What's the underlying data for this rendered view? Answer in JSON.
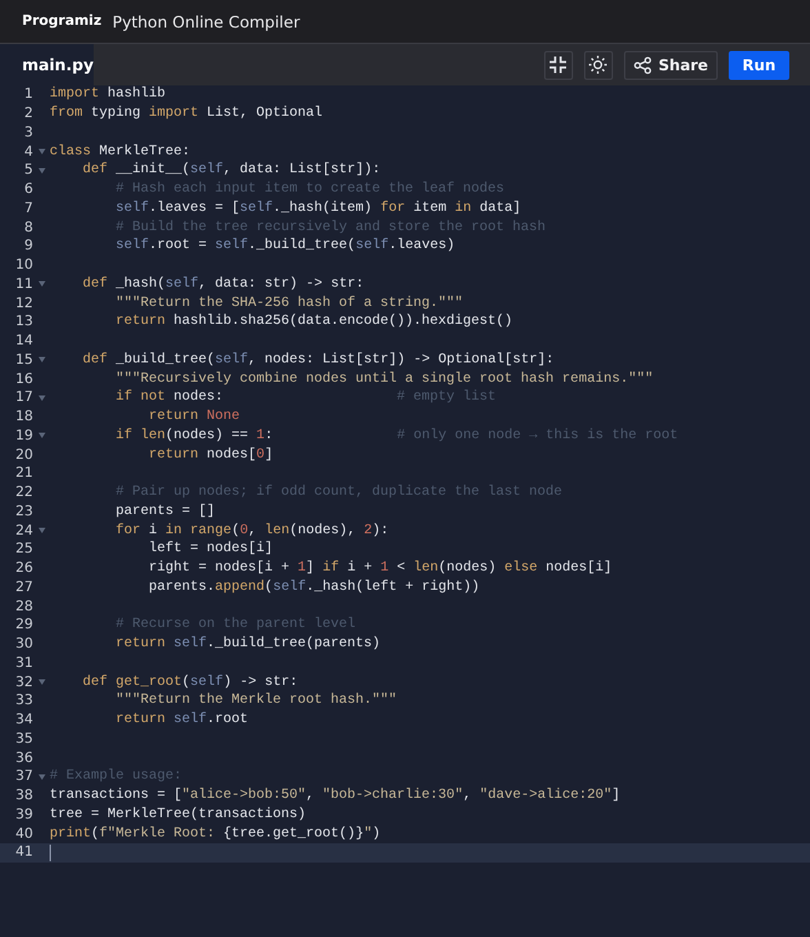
{
  "header": {
    "brand": "Programiz",
    "title": "Python Online Compiler"
  },
  "tabs": [
    {
      "label": "main.py",
      "selected": true
    }
  ],
  "toolbar": {
    "share": "Share",
    "run": "Run"
  },
  "editor": {
    "lines": [
      {
        "number": "1",
        "foldable": false,
        "active": false,
        "tokens": [
          {
            "kind": "keyword",
            "text": "import"
          },
          {
            "kind": "plain",
            "text": " hashlib"
          }
        ]
      },
      {
        "number": "2",
        "foldable": false,
        "active": false,
        "tokens": [
          {
            "kind": "keyword",
            "text": "from"
          },
          {
            "kind": "plain",
            "text": " typing "
          },
          {
            "kind": "keyword",
            "text": "import"
          },
          {
            "kind": "plain",
            "text": " List, Optional"
          }
        ]
      },
      {
        "number": "3",
        "foldable": false,
        "active": false
      },
      {
        "number": "4",
        "foldable": true,
        "active": false,
        "tokens": [
          {
            "kind": "keyword",
            "text": "class"
          },
          {
            "kind": "plain",
            "text": " MerkleTree:"
          }
        ]
      },
      {
        "number": "5",
        "foldable": true,
        "active": false,
        "tokens": [
          {
            "kind": "keyword",
            "text": "    def"
          },
          {
            "kind": "plain",
            "text": " __init__("
          },
          {
            "kind": "self",
            "text": "self"
          },
          {
            "kind": "plain",
            "text": ", data: List[str]):"
          }
        ]
      },
      {
        "number": "6",
        "foldable": false,
        "active": false,
        "tokens": [
          {
            "kind": "comment",
            "text": "        # Hash each input item to create the leaf nodes"
          }
        ]
      },
      {
        "number": "7",
        "foldable": false,
        "active": false,
        "tokens": [
          {
            "kind": "self",
            "text": "        self"
          },
          {
            "kind": "plain",
            "text": ".leaves = ["
          },
          {
            "kind": "self",
            "text": "self"
          },
          {
            "kind": "plain",
            "text": "._hash(item) "
          },
          {
            "kind": "keyword",
            "text": "for"
          },
          {
            "kind": "plain",
            "text": " item "
          },
          {
            "kind": "keyword",
            "text": "in"
          },
          {
            "kind": "plain",
            "text": " data]"
          }
        ]
      },
      {
        "number": "8",
        "foldable": false,
        "active": false,
        "tokens": [
          {
            "kind": "comment",
            "text": "        # Build the tree recursively and store the root hash"
          }
        ]
      },
      {
        "number": "9",
        "foldable": false,
        "active": false,
        "tokens": [
          {
            "kind": "self",
            "text": "        self"
          },
          {
            "kind": "plain",
            "text": ".root = "
          },
          {
            "kind": "self",
            "text": "self"
          },
          {
            "kind": "plain",
            "text": "._build_tree("
          },
          {
            "kind": "self",
            "text": "self"
          },
          {
            "kind": "plain",
            "text": ".leaves)"
          }
        ]
      },
      {
        "number": "10",
        "foldable": false,
        "active": false
      },
      {
        "number": "11",
        "foldable": true,
        "active": false,
        "tokens": [
          {
            "kind": "keyword",
            "text": "    def"
          },
          {
            "kind": "plain",
            "text": " _hash("
          },
          {
            "kind": "self",
            "text": "self"
          },
          {
            "kind": "plain",
            "text": ", data: str) -> str:"
          }
        ]
      },
      {
        "number": "12",
        "foldable": false,
        "active": false,
        "tokens": [
          {
            "kind": "string",
            "text": "        \"\"\"Return the SHA-256 hash of a string.\"\"\""
          }
        ]
      },
      {
        "number": "13",
        "foldable": false,
        "active": false,
        "tokens": [
          {
            "kind": "keyword",
            "text": "        return"
          },
          {
            "kind": "plain",
            "text": " hashlib.sha256(data.encode()).hexdigest()"
          }
        ]
      },
      {
        "number": "14",
        "foldable": false,
        "active": false
      },
      {
        "number": "15",
        "foldable": true,
        "active": false,
        "tokens": [
          {
            "kind": "keyword",
            "text": "    def"
          },
          {
            "kind": "plain",
            "text": " _build_tree("
          },
          {
            "kind": "self",
            "text": "self"
          },
          {
            "kind": "plain",
            "text": ", nodes: List[str]) -> Optional[str]:"
          }
        ]
      },
      {
        "number": "16",
        "foldable": false,
        "active": false,
        "tokens": [
          {
            "kind": "string",
            "text": "        \"\"\"Recursively combine nodes until a single root hash remains.\"\"\""
          }
        ]
      },
      {
        "number": "17",
        "foldable": true,
        "active": false,
        "tokens": [
          {
            "kind": "keyword",
            "text": "        if not"
          },
          {
            "kind": "plain",
            "text": " nodes:                     "
          },
          {
            "kind": "comment",
            "text": "# empty list"
          }
        ]
      },
      {
        "number": "18",
        "foldable": false,
        "active": false,
        "tokens": [
          {
            "kind": "keyword",
            "text": "            return"
          },
          {
            "kind": "number",
            "text": " None"
          }
        ]
      },
      {
        "number": "19",
        "foldable": true,
        "active": false,
        "tokens": [
          {
            "kind": "keyword",
            "text": "        if"
          },
          {
            "kind": "builtin",
            "text": " len"
          },
          {
            "kind": "plain",
            "text": "(nodes) == "
          },
          {
            "kind": "number",
            "text": "1"
          },
          {
            "kind": "plain",
            "text": ":               "
          },
          {
            "kind": "comment",
            "text": "# only one node → this is the root"
          }
        ]
      },
      {
        "number": "20",
        "foldable": false,
        "active": false,
        "tokens": [
          {
            "kind": "keyword",
            "text": "            return"
          },
          {
            "kind": "plain",
            "text": " nodes["
          },
          {
            "kind": "number",
            "text": "0"
          },
          {
            "kind": "plain",
            "text": "]"
          }
        ]
      },
      {
        "number": "21",
        "foldable": false,
        "active": false
      },
      {
        "number": "22",
        "foldable": false,
        "active": false,
        "tokens": [
          {
            "kind": "comment",
            "text": "        # Pair up nodes; if odd count, duplicate the last node"
          }
        ]
      },
      {
        "number": "23",
        "foldable": false,
        "active": false,
        "tokens": [
          {
            "kind": "plain",
            "text": "        parents = []"
          }
        ]
      },
      {
        "number": "24",
        "foldable": true,
        "active": false,
        "tokens": [
          {
            "kind": "keyword",
            "text": "        for"
          },
          {
            "kind": "plain",
            "text": " i "
          },
          {
            "kind": "keyword",
            "text": "in"
          },
          {
            "kind": "builtin",
            "text": " range"
          },
          {
            "kind": "plain",
            "text": "("
          },
          {
            "kind": "number",
            "text": "0"
          },
          {
            "kind": "plain",
            "text": ", "
          },
          {
            "kind": "builtin",
            "text": "len"
          },
          {
            "kind": "plain",
            "text": "(nodes), "
          },
          {
            "kind": "number",
            "text": "2"
          },
          {
            "kind": "plain",
            "text": "):"
          }
        ]
      },
      {
        "number": "25",
        "foldable": false,
        "active": false,
        "tokens": [
          {
            "kind": "plain",
            "text": "            left = nodes[i]"
          }
        ]
      },
      {
        "number": "26",
        "foldable": false,
        "active": false,
        "tokens": [
          {
            "kind": "plain",
            "text": "            right = nodes[i + "
          },
          {
            "kind": "number",
            "text": "1"
          },
          {
            "kind": "plain",
            "text": "] "
          },
          {
            "kind": "keyword",
            "text": "if"
          },
          {
            "kind": "plain",
            "text": " i + "
          },
          {
            "kind": "number",
            "text": "1"
          },
          {
            "kind": "plain",
            "text": " < "
          },
          {
            "kind": "builtin",
            "text": "len"
          },
          {
            "kind": "plain",
            "text": "(nodes) "
          },
          {
            "kind": "keyword",
            "text": "else"
          },
          {
            "kind": "plain",
            "text": " nodes[i]"
          }
        ]
      },
      {
        "number": "27",
        "foldable": false,
        "active": false,
        "tokens": [
          {
            "kind": "plain",
            "text": "            parents."
          },
          {
            "kind": "builtin",
            "text": "append"
          },
          {
            "kind": "plain",
            "text": "("
          },
          {
            "kind": "self",
            "text": "self"
          },
          {
            "kind": "plain",
            "text": "._hash(left + right))"
          }
        ]
      },
      {
        "number": "28",
        "foldable": false,
        "active": false
      },
      {
        "number": "29",
        "foldable": false,
        "active": false,
        "tokens": [
          {
            "kind": "comment",
            "text": "        # Recurse on the parent level"
          }
        ]
      },
      {
        "number": "30",
        "foldable": false,
        "active": false,
        "tokens": [
          {
            "kind": "keyword",
            "text": "        return"
          },
          {
            "kind": "self",
            "text": " self"
          },
          {
            "kind": "plain",
            "text": "._build_tree(parents)"
          }
        ]
      },
      {
        "number": "31",
        "foldable": false,
        "active": false
      },
      {
        "number": "32",
        "foldable": true,
        "active": false,
        "tokens": [
          {
            "kind": "keyword",
            "text": "    def"
          },
          {
            "kind": "builtin",
            "text": " get_root"
          },
          {
            "kind": "plain",
            "text": "("
          },
          {
            "kind": "self",
            "text": "self"
          },
          {
            "kind": "plain",
            "text": ") -> str:"
          }
        ]
      },
      {
        "number": "33",
        "foldable": false,
        "active": false,
        "tokens": [
          {
            "kind": "string",
            "text": "        \"\"\"Return the Merkle root hash.\"\"\""
          }
        ]
      },
      {
        "number": "34",
        "foldable": false,
        "active": false,
        "tokens": [
          {
            "kind": "keyword",
            "text": "        return"
          },
          {
            "kind": "self",
            "text": " self"
          },
          {
            "kind": "plain",
            "text": ".root"
          }
        ]
      },
      {
        "number": "35",
        "foldable": false,
        "active": false
      },
      {
        "number": "36",
        "foldable": false,
        "active": false
      },
      {
        "number": "37",
        "foldable": true,
        "active": false,
        "tokens": [
          {
            "kind": "comment",
            "text": "# Example usage:"
          }
        ]
      },
      {
        "number": "38",
        "foldable": false,
        "active": false,
        "tokens": [
          {
            "kind": "plain",
            "text": "transactions = ["
          },
          {
            "kind": "string",
            "text": "\"alice->bob:50\""
          },
          {
            "kind": "plain",
            "text": ", "
          },
          {
            "kind": "string",
            "text": "\"bob->charlie:30\""
          },
          {
            "kind": "plain",
            "text": ", "
          },
          {
            "kind": "string",
            "text": "\"dave->alice:20\""
          },
          {
            "kind": "plain",
            "text": "]"
          }
        ]
      },
      {
        "number": "39",
        "foldable": false,
        "active": false,
        "tokens": [
          {
            "kind": "plain",
            "text": "tree = MerkleTree(transactions)"
          }
        ]
      },
      {
        "number": "40",
        "foldable": false,
        "active": false,
        "tokens": [
          {
            "kind": "builtin",
            "text": "print"
          },
          {
            "kind": "plain",
            "text": "("
          },
          {
            "kind": "string",
            "text": "f\"Merkle Root: "
          },
          {
            "kind": "plain",
            "text": "{tree.get_root()}"
          },
          {
            "kind": "string",
            "text": "\""
          },
          {
            "kind": "plain",
            "text": ")"
          }
        ]
      },
      {
        "number": "41",
        "foldable": false,
        "active": true
      }
    ]
  }
}
